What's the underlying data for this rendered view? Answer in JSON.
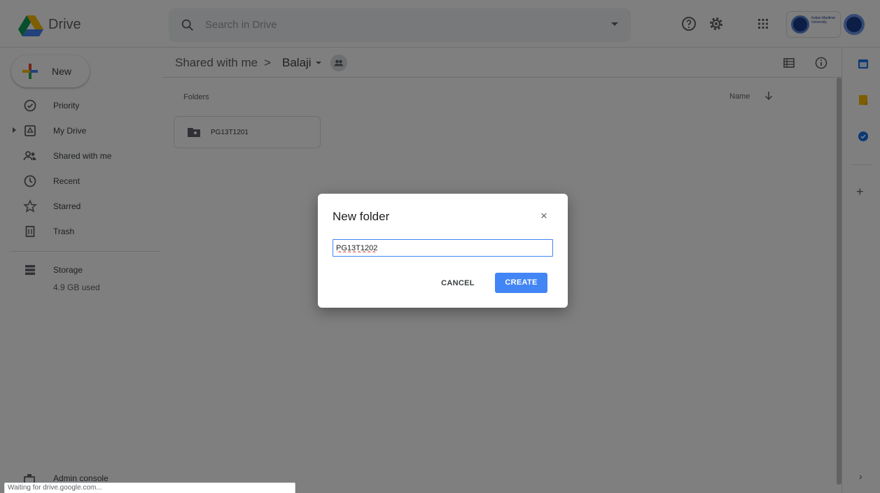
{
  "app": {
    "name": "Drive"
  },
  "header": {
    "search_placeholder": "Search in Drive",
    "icons": [
      "drive-logo-icon",
      "search-icon",
      "help-icon",
      "settings-icon",
      "apps-grid-icon"
    ],
    "org_badge_text": "Indian Maritime University"
  },
  "sidebar": {
    "new_label": "New",
    "items": [
      {
        "label": "Priority",
        "icon": "priority-icon"
      },
      {
        "label": "My Drive",
        "icon": "my-drive-icon"
      },
      {
        "label": "Shared with me",
        "icon": "shared-icon"
      },
      {
        "label": "Recent",
        "icon": "clock-icon"
      },
      {
        "label": "Starred",
        "icon": "star-icon"
      },
      {
        "label": "Trash",
        "icon": "trash-icon"
      }
    ],
    "storage": {
      "label": "Storage",
      "used": "4.9 GB used"
    },
    "admin_label": "Admin console"
  },
  "main": {
    "breadcrumb": {
      "root": "Shared with me",
      "separator": ">",
      "current": "Balaji"
    },
    "folders_heading": "Folders",
    "sort_label": "Name",
    "folders": [
      {
        "name": "PG13T1201"
      }
    ]
  },
  "dialog": {
    "title": "New folder",
    "close": "×",
    "input_value": "PG13T1202",
    "cancel_label": "CANCEL",
    "create_label": "CREATE"
  },
  "status": {
    "text": "Waiting for drive.google.com..."
  },
  "colors": {
    "accent": "#4285f4",
    "overlay": "rgba(0,0,0,0.5)",
    "keep": "#fbbc04",
    "tasks": "#1a73e8"
  }
}
